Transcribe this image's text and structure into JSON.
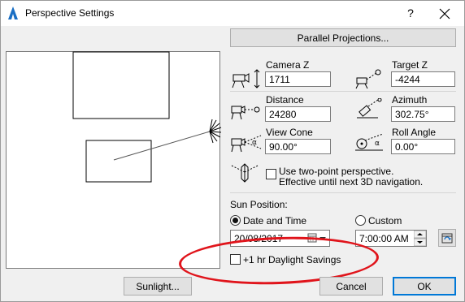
{
  "window": {
    "title": "Perspective Settings",
    "help_glyph": "?",
    "close_icon": "close-icon",
    "app_icon": "archicad-icon"
  },
  "projections_button": "Parallel Projections...",
  "camera_z": {
    "label": "Camera Z",
    "value": "1711"
  },
  "target_z": {
    "label": "Target Z",
    "value": "-4244"
  },
  "distance": {
    "label": "Distance",
    "value": "24280"
  },
  "azimuth": {
    "label": "Azimuth",
    "value": "302.75°"
  },
  "view_cone": {
    "label": "View Cone",
    "value": "90.00°"
  },
  "roll_angle": {
    "label": "Roll Angle",
    "value": "0.00°"
  },
  "two_point": {
    "line1": "Use two-point perspective.",
    "line2": "Effective until next 3D navigation.",
    "checked": false
  },
  "sun": {
    "heading": "Sun Position:",
    "date_time_label": "Date and Time",
    "custom_label": "Custom",
    "selected": "Date and Time",
    "date_value": "20/08/2017",
    "time_value": "7:00:00 AM",
    "daylight_label": "+1 hr Daylight Savings",
    "daylight_checked": false
  },
  "buttons": {
    "sunlight": "Sunlight...",
    "cancel": "Cancel",
    "ok": "OK"
  },
  "colors": {
    "highlight_oval": "#e0141b",
    "default_button_border": "#0078d7"
  }
}
